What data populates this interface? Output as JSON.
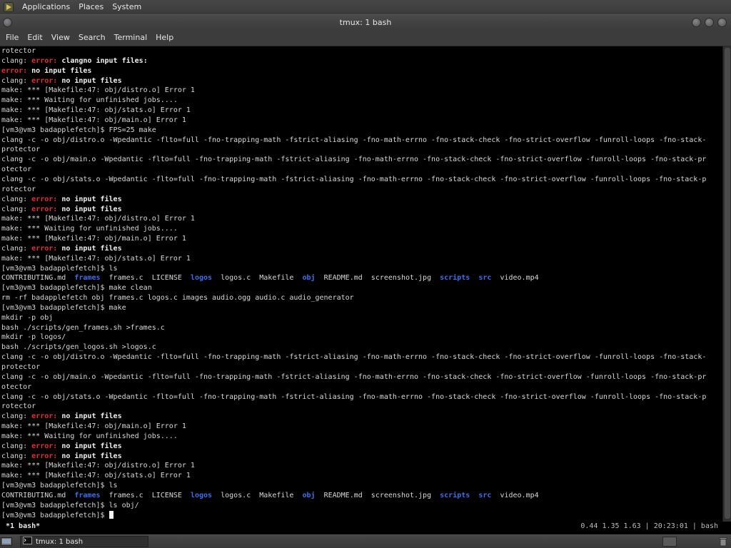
{
  "top_panel": {
    "menus": [
      "Applications",
      "Places",
      "System"
    ]
  },
  "window": {
    "title": "tmux: 1 bash"
  },
  "menubar": {
    "items": [
      "File",
      "Edit",
      "View",
      "Search",
      "Terminal",
      "Help"
    ]
  },
  "colors": {
    "error": "#e0303a",
    "directory": "#3f6fe8",
    "text": "#d8d8d8",
    "background": "#000000"
  },
  "terminal": {
    "lines": [
      [
        {
          "t": "rotector"
        }
      ],
      [
        {
          "t": "clang: "
        },
        {
          "t": "error: ",
          "c": "err"
        },
        {
          "t": "clangno input files:",
          "c": "bold"
        }
      ],
      [
        {
          "t": "error: ",
          "c": "err"
        },
        {
          "t": "no input files",
          "c": "bold"
        }
      ],
      [
        {
          "t": "clang: "
        },
        {
          "t": "error: ",
          "c": "err"
        },
        {
          "t": "no input files",
          "c": "bold"
        }
      ],
      [
        {
          "t": "make: *** [Makefile:47: obj/distro.o] Error 1"
        }
      ],
      [
        {
          "t": "make: *** Waiting for unfinished jobs...."
        }
      ],
      [
        {
          "t": "make: *** [Makefile:47: obj/stats.o] Error 1"
        }
      ],
      [
        {
          "t": "make: *** [Makefile:47: obj/main.o] Error 1"
        }
      ],
      [
        {
          "t": "[vm3@vm3 badapplefetch]$ FPS=25 make"
        }
      ],
      [
        {
          "t": "clang -c -o obj/distro.o -Wpedantic -flto=full -fno-trapping-math -fstrict-aliasing -fno-math-errno -fno-stack-check -fno-strict-overflow -funroll-loops -fno-stack-"
        }
      ],
      [
        {
          "t": "protector"
        }
      ],
      [
        {
          "t": "clang -c -o obj/main.o -Wpedantic -flto=full -fno-trapping-math -fstrict-aliasing -fno-math-errno -fno-stack-check -fno-strict-overflow -funroll-loops -fno-stack-pr"
        }
      ],
      [
        {
          "t": "otector"
        }
      ],
      [
        {
          "t": "clang -c -o obj/stats.o -Wpedantic -flto=full -fno-trapping-math -fstrict-aliasing -fno-math-errno -fno-stack-check -fno-strict-overflow -funroll-loops -fno-stack-p"
        }
      ],
      [
        {
          "t": "rotector"
        }
      ],
      [
        {
          "t": "clang: "
        },
        {
          "t": "error: ",
          "c": "err"
        },
        {
          "t": "no input files",
          "c": "bold"
        }
      ],
      [
        {
          "t": "clang: "
        },
        {
          "t": "error: ",
          "c": "err"
        },
        {
          "t": "no input files",
          "c": "bold"
        }
      ],
      [
        {
          "t": "make: *** [Makefile:47: obj/distro.o] Error 1"
        }
      ],
      [
        {
          "t": "make: *** Waiting for unfinished jobs...."
        }
      ],
      [
        {
          "t": "make: *** [Makefile:47: obj/main.o] Error 1"
        }
      ],
      [
        {
          "t": "clang: "
        },
        {
          "t": "error: ",
          "c": "err"
        },
        {
          "t": "no input files",
          "c": "bold"
        }
      ],
      [
        {
          "t": "make: *** [Makefile:47: obj/stats.o] Error 1"
        }
      ],
      [
        {
          "t": "[vm3@vm3 badapplefetch]$ ls"
        }
      ],
      [
        {
          "t": "CONTRIBUTING.md  "
        },
        {
          "t": "frames",
          "c": "dir"
        },
        {
          "t": "  frames.c  LICENSE  "
        },
        {
          "t": "logos",
          "c": "dir"
        },
        {
          "t": "  logos.c  Makefile  "
        },
        {
          "t": "obj",
          "c": "dir"
        },
        {
          "t": "  README.md  screenshot.jpg  "
        },
        {
          "t": "scripts",
          "c": "dir"
        },
        {
          "t": "  "
        },
        {
          "t": "src",
          "c": "dir"
        },
        {
          "t": "  video.mp4"
        }
      ],
      [
        {
          "t": "[vm3@vm3 badapplefetch]$ make clean"
        }
      ],
      [
        {
          "t": "rm -rf badapplefetch obj frames.c logos.c images audio.ogg audio.c audio_generator"
        }
      ],
      [
        {
          "t": "[vm3@vm3 badapplefetch]$ make"
        }
      ],
      [
        {
          "t": "mkdir -p obj"
        }
      ],
      [
        {
          "t": "bash ./scripts/gen_frames.sh >frames.c"
        }
      ],
      [
        {
          "t": "mkdir -p logos/"
        }
      ],
      [
        {
          "t": "bash ./scripts/gen_logos.sh >logos.c"
        }
      ],
      [
        {
          "t": "clang -c -o obj/distro.o -Wpedantic -flto=full -fno-trapping-math -fstrict-aliasing -fno-math-errno -fno-stack-check -fno-strict-overflow -funroll-loops -fno-stack-"
        }
      ],
      [
        {
          "t": "protector"
        }
      ],
      [
        {
          "t": "clang -c -o obj/main.o -Wpedantic -flto=full -fno-trapping-math -fstrict-aliasing -fno-math-errno -fno-stack-check -fno-strict-overflow -funroll-loops -fno-stack-pr"
        }
      ],
      [
        {
          "t": "otector"
        }
      ],
      [
        {
          "t": "clang -c -o obj/stats.o -Wpedantic -flto=full -fno-trapping-math -fstrict-aliasing -fno-math-errno -fno-stack-check -fno-strict-overflow -funroll-loops -fno-stack-p"
        }
      ],
      [
        {
          "t": "rotector"
        }
      ],
      [
        {
          "t": "clang: "
        },
        {
          "t": "error: ",
          "c": "err"
        },
        {
          "t": "no input files",
          "c": "bold"
        }
      ],
      [
        {
          "t": "make: *** [Makefile:47: obj/main.o] Error 1"
        }
      ],
      [
        {
          "t": "make: *** Waiting for unfinished jobs...."
        }
      ],
      [
        {
          "t": "clang: "
        },
        {
          "t": "error: ",
          "c": "err"
        },
        {
          "t": "no input files",
          "c": "bold"
        }
      ],
      [
        {
          "t": "clang: "
        },
        {
          "t": "error: ",
          "c": "err"
        },
        {
          "t": "no input files",
          "c": "bold"
        }
      ],
      [
        {
          "t": "make: *** [Makefile:47: obj/distro.o] Error 1"
        }
      ],
      [
        {
          "t": "make: *** [Makefile:47: obj/stats.o] Error 1"
        }
      ],
      [
        {
          "t": "[vm3@vm3 badapplefetch]$ ls"
        }
      ],
      [
        {
          "t": "CONTRIBUTING.md  "
        },
        {
          "t": "frames",
          "c": "dir"
        },
        {
          "t": "  frames.c  LICENSE  "
        },
        {
          "t": "logos",
          "c": "dir"
        },
        {
          "t": "  logos.c  Makefile  "
        },
        {
          "t": "obj",
          "c": "dir"
        },
        {
          "t": "  README.md  screenshot.jpg  "
        },
        {
          "t": "scripts",
          "c": "dir"
        },
        {
          "t": "  "
        },
        {
          "t": "src",
          "c": "dir"
        },
        {
          "t": "  video.mp4"
        }
      ],
      [
        {
          "t": "[vm3@vm3 badapplefetch]$ ls obj/"
        }
      ],
      [
        {
          "t": "[vm3@vm3 badapplefetch]$ "
        },
        {
          "t": "",
          "c": "cursor"
        }
      ]
    ]
  },
  "tmux_status": {
    "left": "*1 bash*",
    "right": "0.44 1.35 1.63 | 20:23:01 | bash"
  },
  "taskbar": {
    "item_label": "tmux: 1 bash"
  }
}
